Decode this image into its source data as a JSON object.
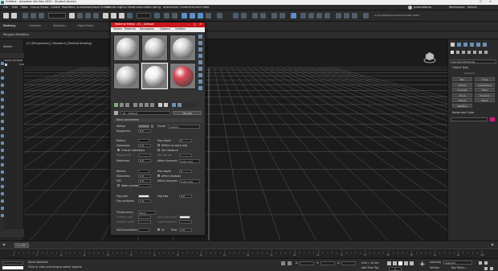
{
  "app": {
    "window_title": "Untitled - Autodesk 3ds Max 2020 - Student Version",
    "accent": "#c8161d"
  },
  "menubar": {
    "items": [
      "File",
      "Edit",
      "Tools",
      "Group",
      "Views",
      "Create",
      "Modifiers",
      "Animation",
      "Graph Editors",
      "Rendering",
      "Civil View",
      "Customize",
      "Scripting",
      "Interactive",
      "Content",
      "Arnold",
      "Help"
    ],
    "user": "jnasirallama",
    "workspaces_label": "Workspaces:",
    "workspaces_value": "Default",
    "path": "C:\\Users\\b\\Documents\\3ds Max 2020"
  },
  "ribbon": {
    "tabs": [
      "Modeling",
      "Freeform",
      "Selection",
      "Object Paint"
    ],
    "sub": "Polygon Modeling"
  },
  "scene_explorer": {
    "header": "Select",
    "item": "Name (Sorted)",
    "value": "0.00"
  },
  "viewport": {
    "label": "[+] [Perspective] [ Standard ] [Default Shading]"
  },
  "command_panel": {
    "dropdown": "Standard Primitives",
    "rollout_object_type": "Object Type",
    "autogrid": "AutoGrid",
    "buttons": [
      "Box",
      "Cone",
      "Sphere",
      "GeoSphere",
      "Cylinder",
      "Tube",
      "Torus",
      "Pyramid",
      "Teapot",
      "Plane",
      "TextPlus"
    ],
    "rollout_name_color": "Name and Color",
    "color": "#d11a7a"
  },
  "material_editor": {
    "title": "Material Editor - 01 - Default",
    "menu": [
      "Modes",
      "Material",
      "Navigation",
      "Options",
      "Utilities"
    ],
    "slots": [
      {
        "color": "#d8d8d8",
        "selected": false
      },
      {
        "color": "#d8d8d8",
        "selected": false
      },
      {
        "color": "#d8d8d8",
        "selected": false
      },
      {
        "color": "#d8d8d8",
        "selected": false
      },
      {
        "color": "#f0f0f0",
        "selected": true
      },
      {
        "color": "#d94b55",
        "selected": false
      }
    ],
    "mat_name": "01 - Default",
    "mat_type": "VRayMtl",
    "rollout": "Basic parameters",
    "params": {
      "diffuse": "Diffuse",
      "roughness": "Roughness",
      "roughness_val": "0.0",
      "preset": "Preset",
      "preset_val": "Custom",
      "reflect": "Reflect",
      "max_depth": "Max depth",
      "max_depth_val": "5",
      "glossiness": "Glossiness",
      "glossiness_val": "1.0",
      "reflect_on_back": "Reflect on back side",
      "fresnel": "Fresnel reflections",
      "dim_distance": "Dim distance",
      "fresnel_ior": "Fresnel IOR",
      "dim_falloff": "Dim fall off",
      "metalness": "Metalness",
      "metalness_val": "0.0",
      "affect_channels": "Affect channels",
      "affect_channels_val": "Color only",
      "refract": "Refract",
      "refract_depth_val": "5",
      "refract_gloss_val": "1.0",
      "affect_shadows": "Affect shadows",
      "ior": "IOR",
      "ior_val": "1.6",
      "abbe": "Abbe number",
      "fog_color": "Fog color",
      "fog_bias": "Fog bias",
      "fog_bias_val": "0.0",
      "fog_multiplier": "Fog multiplier",
      "fog_multiplier_val": "1.0",
      "translucency": "Translucency",
      "translucency_val": "None",
      "scatter_coeff": "Scatter coeff",
      "back_side_color": "Back-side color",
      "fwd_bck_coeff": "Fwd/bck coeff",
      "light_multiplier": "Light multiplier",
      "self_illumination": "Self-illumination",
      "gi": "GI",
      "mult": "Mult",
      "mult_val": "1.0"
    }
  },
  "timeline": {
    "frame": "0 / 100",
    "ticks": [
      "0",
      "5",
      "10",
      "15",
      "20",
      "25",
      "30",
      "35",
      "40",
      "45",
      "50",
      "55",
      "60",
      "65",
      "70",
      "75",
      "80",
      "85",
      "90",
      "95",
      "100"
    ]
  },
  "statusbar": {
    "line1": "None Selected",
    "line2": "Click or click-and-drag to select objects",
    "x_label": "X:",
    "y_label": "Y:",
    "z_label": "Z:",
    "grid": "Grid = 10.0m",
    "add_time_tag": "Add Time Tag",
    "auto_key": "Auto Key",
    "selected": "Selected",
    "set_key": "Set Key",
    "key_filters": "Key Filters...",
    "frame_val": "0"
  }
}
